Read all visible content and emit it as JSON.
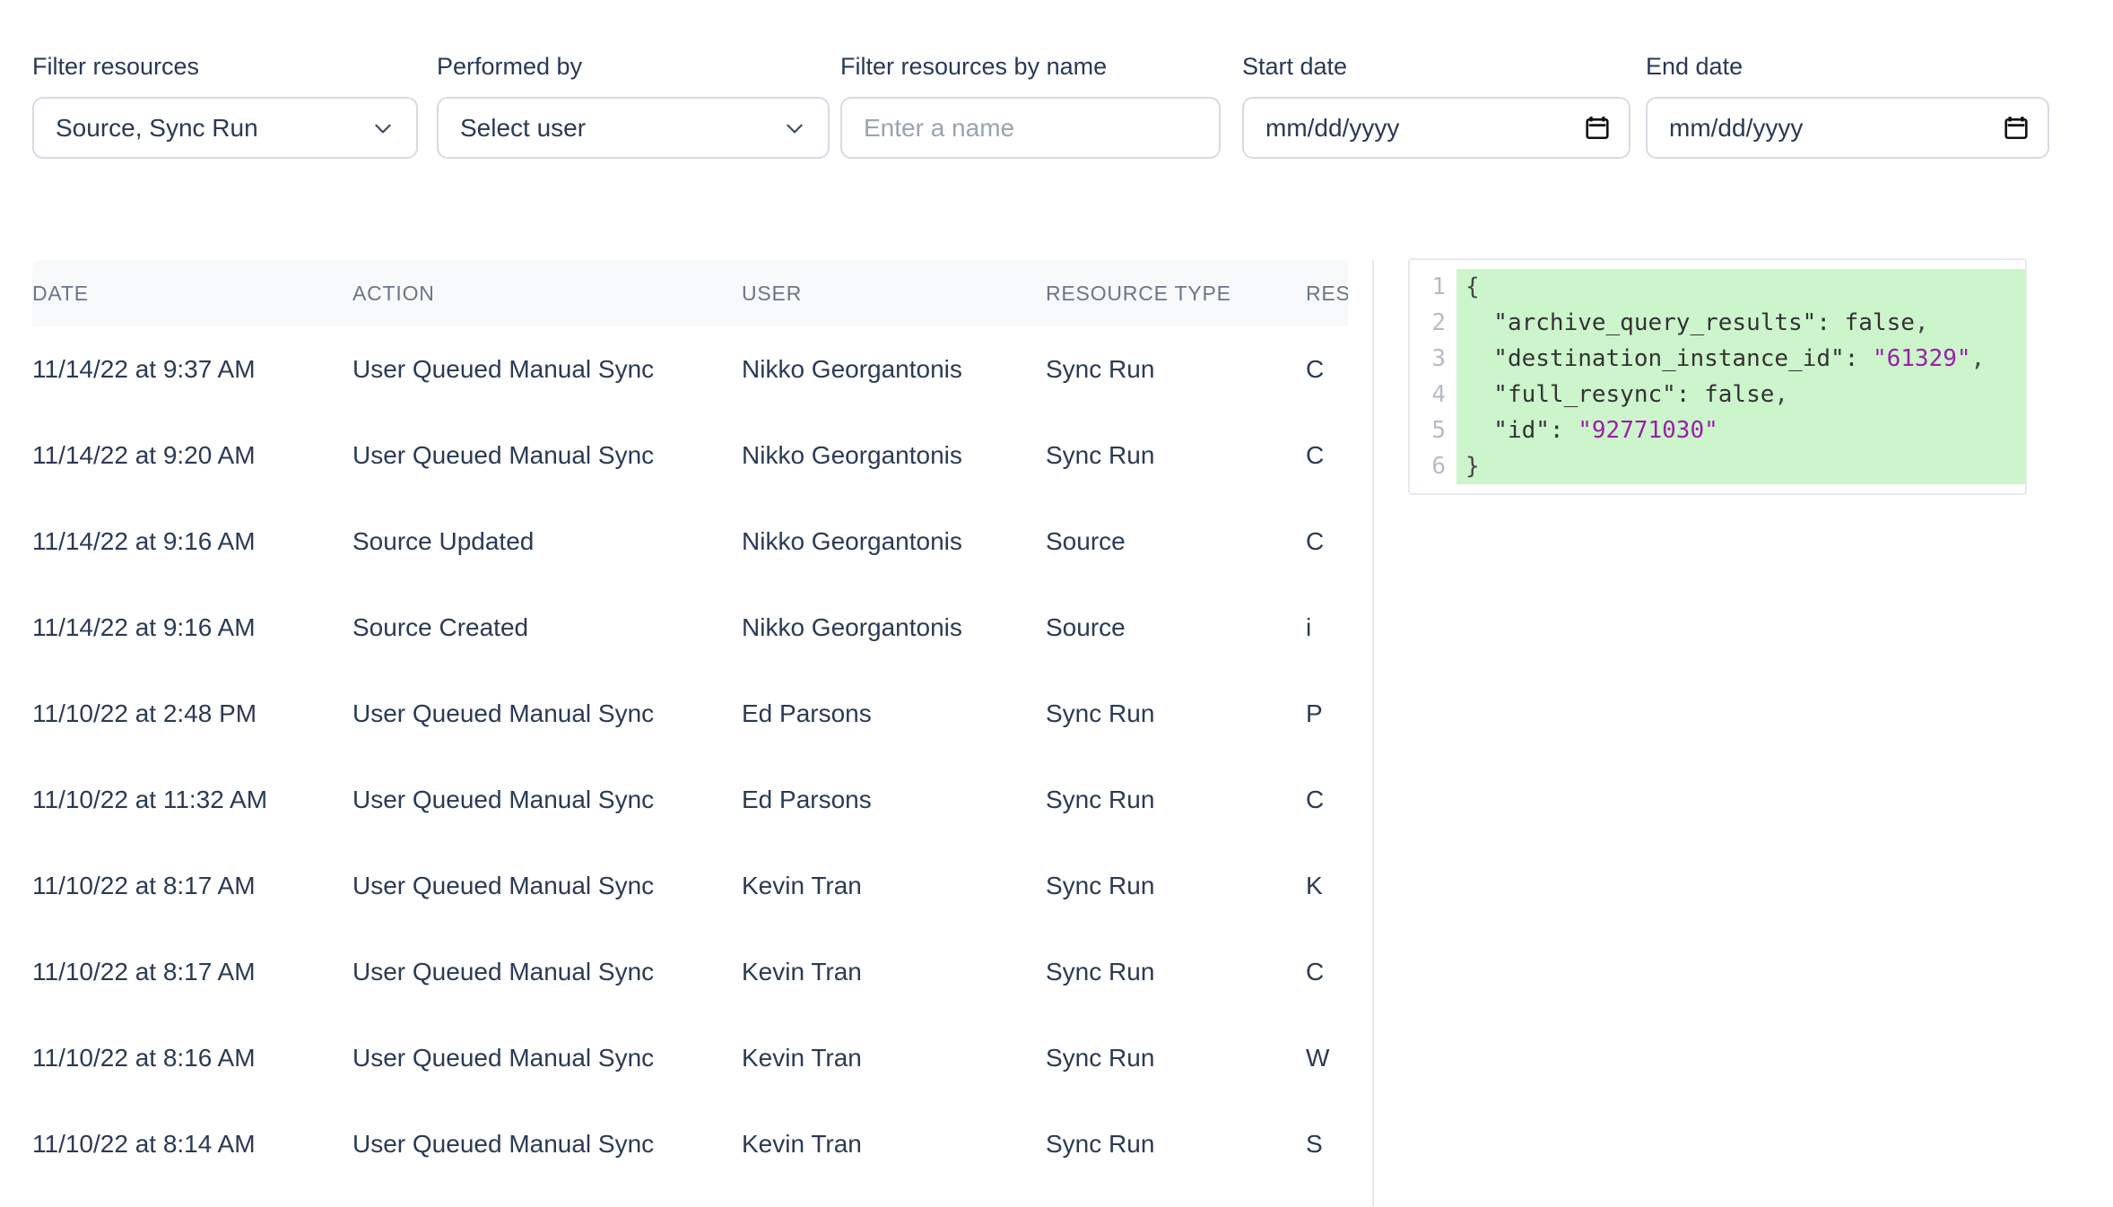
{
  "filters": {
    "resources": {
      "label": "Filter resources",
      "value": "Source, Sync Run",
      "icon": "chevron-down-icon"
    },
    "performed_by": {
      "label": "Performed by",
      "value": "Select user",
      "icon": "chevron-down-icon"
    },
    "resource_name": {
      "label": "Filter resources by name",
      "value": "",
      "placeholder": "Enter a name"
    },
    "start_date": {
      "label": "Start date",
      "value": "",
      "placeholder": "mm/dd/yyyy",
      "icon": "calendar-icon"
    },
    "end_date": {
      "label": "End date",
      "value": "",
      "placeholder": "mm/dd/yyyy",
      "icon": "calendar-icon"
    }
  },
  "table": {
    "columns": [
      "DATE",
      "ACTION",
      "USER",
      "RESOURCE TYPE",
      "RESOURCE NAME"
    ],
    "rows": [
      {
        "date": "11/14/22 at 9:37 AM",
        "action": "User Queued Manual Sync",
        "user": "Nikko Georgantonis",
        "resource_type": "Sync Run",
        "resource_name": "C"
      },
      {
        "date": "11/14/22 at 9:20 AM",
        "action": "User Queued Manual Sync",
        "user": "Nikko Georgantonis",
        "resource_type": "Sync Run",
        "resource_name": "C"
      },
      {
        "date": "11/14/22 at 9:16 AM",
        "action": "Source Updated",
        "user": "Nikko Georgantonis",
        "resource_type": "Source",
        "resource_name": "C"
      },
      {
        "date": "11/14/22 at 9:16 AM",
        "action": "Source Created",
        "user": "Nikko Georgantonis",
        "resource_type": "Source",
        "resource_name": "i"
      },
      {
        "date": "11/10/22 at 2:48 PM",
        "action": "User Queued Manual Sync",
        "user": "Ed Parsons",
        "resource_type": "Sync Run",
        "resource_name": "P"
      },
      {
        "date": "11/10/22 at 11:32 AM",
        "action": "User Queued Manual Sync",
        "user": "Ed Parsons",
        "resource_type": "Sync Run",
        "resource_name": "C"
      },
      {
        "date": "11/10/22 at 8:17 AM",
        "action": "User Queued Manual Sync",
        "user": "Kevin Tran",
        "resource_type": "Sync Run",
        "resource_name": "K"
      },
      {
        "date": "11/10/22 at 8:17 AM",
        "action": "User Queued Manual Sync",
        "user": "Kevin Tran",
        "resource_type": "Sync Run",
        "resource_name": "C"
      },
      {
        "date": "11/10/22 at 8:16 AM",
        "action": "User Queued Manual Sync",
        "user": "Kevin Tran",
        "resource_type": "Sync Run",
        "resource_name": "W"
      },
      {
        "date": "11/10/22 at 8:14 AM",
        "action": "User Queued Manual Sync",
        "user": "Kevin Tran",
        "resource_type": "Sync Run",
        "resource_name": "S"
      }
    ]
  },
  "json_viewer": {
    "line_numbers": [
      "1",
      "2",
      "3",
      "4",
      "5",
      "6"
    ],
    "lines": [
      {
        "indent": "",
        "text": "{",
        "type": "punct"
      },
      {
        "indent": "  ",
        "key": "\"archive_query_results\"",
        "sep": ": ",
        "value": "false",
        "value_type": "bool",
        "trail": ","
      },
      {
        "indent": "  ",
        "key": "\"destination_instance_id\"",
        "sep": ": ",
        "value": "\"61329\"",
        "value_type": "string",
        "trail": ","
      },
      {
        "indent": "  ",
        "key": "\"full_resync\"",
        "sep": ": ",
        "value": "false",
        "value_type": "bool",
        "trail": ","
      },
      {
        "indent": "  ",
        "key": "\"id\"",
        "sep": ": ",
        "value": "\"92771030\"",
        "value_type": "string",
        "trail": ""
      },
      {
        "indent": "",
        "text": "}",
        "type": "punct"
      }
    ],
    "raw": "{\n  \"archive_query_results\": false,\n  \"destination_instance_id\": \"61329\",\n  \"full_resync\": false,\n  \"id\": \"92771030\"\n}",
    "highlight_color": "#ccf5cc",
    "string_color": "#9b1fa8"
  }
}
